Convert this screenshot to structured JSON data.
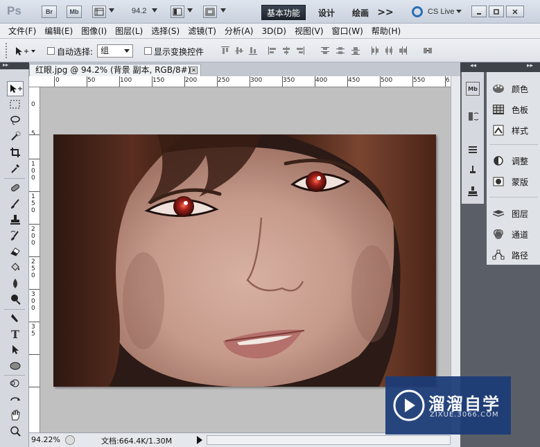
{
  "app": {
    "logo": "Ps",
    "bridge_label": "Br",
    "minibridge_label": "Mb",
    "zoom_value": "94.2",
    "workspaces": [
      "基本功能",
      "设计",
      "绘画"
    ],
    "more_label": ">>",
    "cslive_label": "CS Live",
    "window_controls": [
      "minimize",
      "restore",
      "close"
    ]
  },
  "menu": [
    "文件(F)",
    "编辑(E)",
    "图像(I)",
    "图层(L)",
    "选择(S)",
    "滤镜(T)",
    "分析(A)",
    "3D(D)",
    "视图(V)",
    "窗口(W)",
    "帮助(H)"
  ],
  "options": {
    "auto_select_label": "自动选择:",
    "auto_select_value": "组",
    "show_transform_label": "显示变换控件"
  },
  "document": {
    "tab_title": "红眼.jpg @ 94.2% (背景 副本, RGB/8#) *",
    "ruler_top": [
      "0",
      "50",
      "100",
      "150",
      "200",
      "250",
      "300",
      "350",
      "400",
      "450",
      "500",
      "550",
      "6"
    ],
    "ruler_left": [
      "0",
      "5",
      "1 0 0",
      "1 5 0",
      "2 0 0",
      "2 5 0",
      "3 0 0",
      "3 5"
    ],
    "zoom_status": "94.22%",
    "doc_status": "文档:664.4K/1.30M"
  },
  "panels": [
    {
      "group": "top",
      "items": [
        {
          "label": "颜色",
          "icon": "color-palette-icon"
        },
        {
          "label": "色板",
          "icon": "swatches-icon"
        },
        {
          "label": "样式",
          "icon": "styles-icon"
        }
      ]
    },
    {
      "group": "mid",
      "items": [
        {
          "label": "调整",
          "icon": "adjustments-icon"
        },
        {
          "label": "蒙版",
          "icon": "masks-icon"
        }
      ]
    },
    {
      "group": "bottom",
      "items": [
        {
          "label": "图层",
          "icon": "layers-icon"
        },
        {
          "label": "通道",
          "icon": "channels-icon"
        },
        {
          "label": "路径",
          "icon": "paths-icon"
        }
      ]
    }
  ],
  "watermark": {
    "title": "溜溜自学",
    "url": "ZIXUE.3066.COM"
  },
  "colors": {
    "canvas_bg": "#c0c0c0",
    "dock_bg": "#5a5f67",
    "watermark_bg": "#1c3c78"
  }
}
